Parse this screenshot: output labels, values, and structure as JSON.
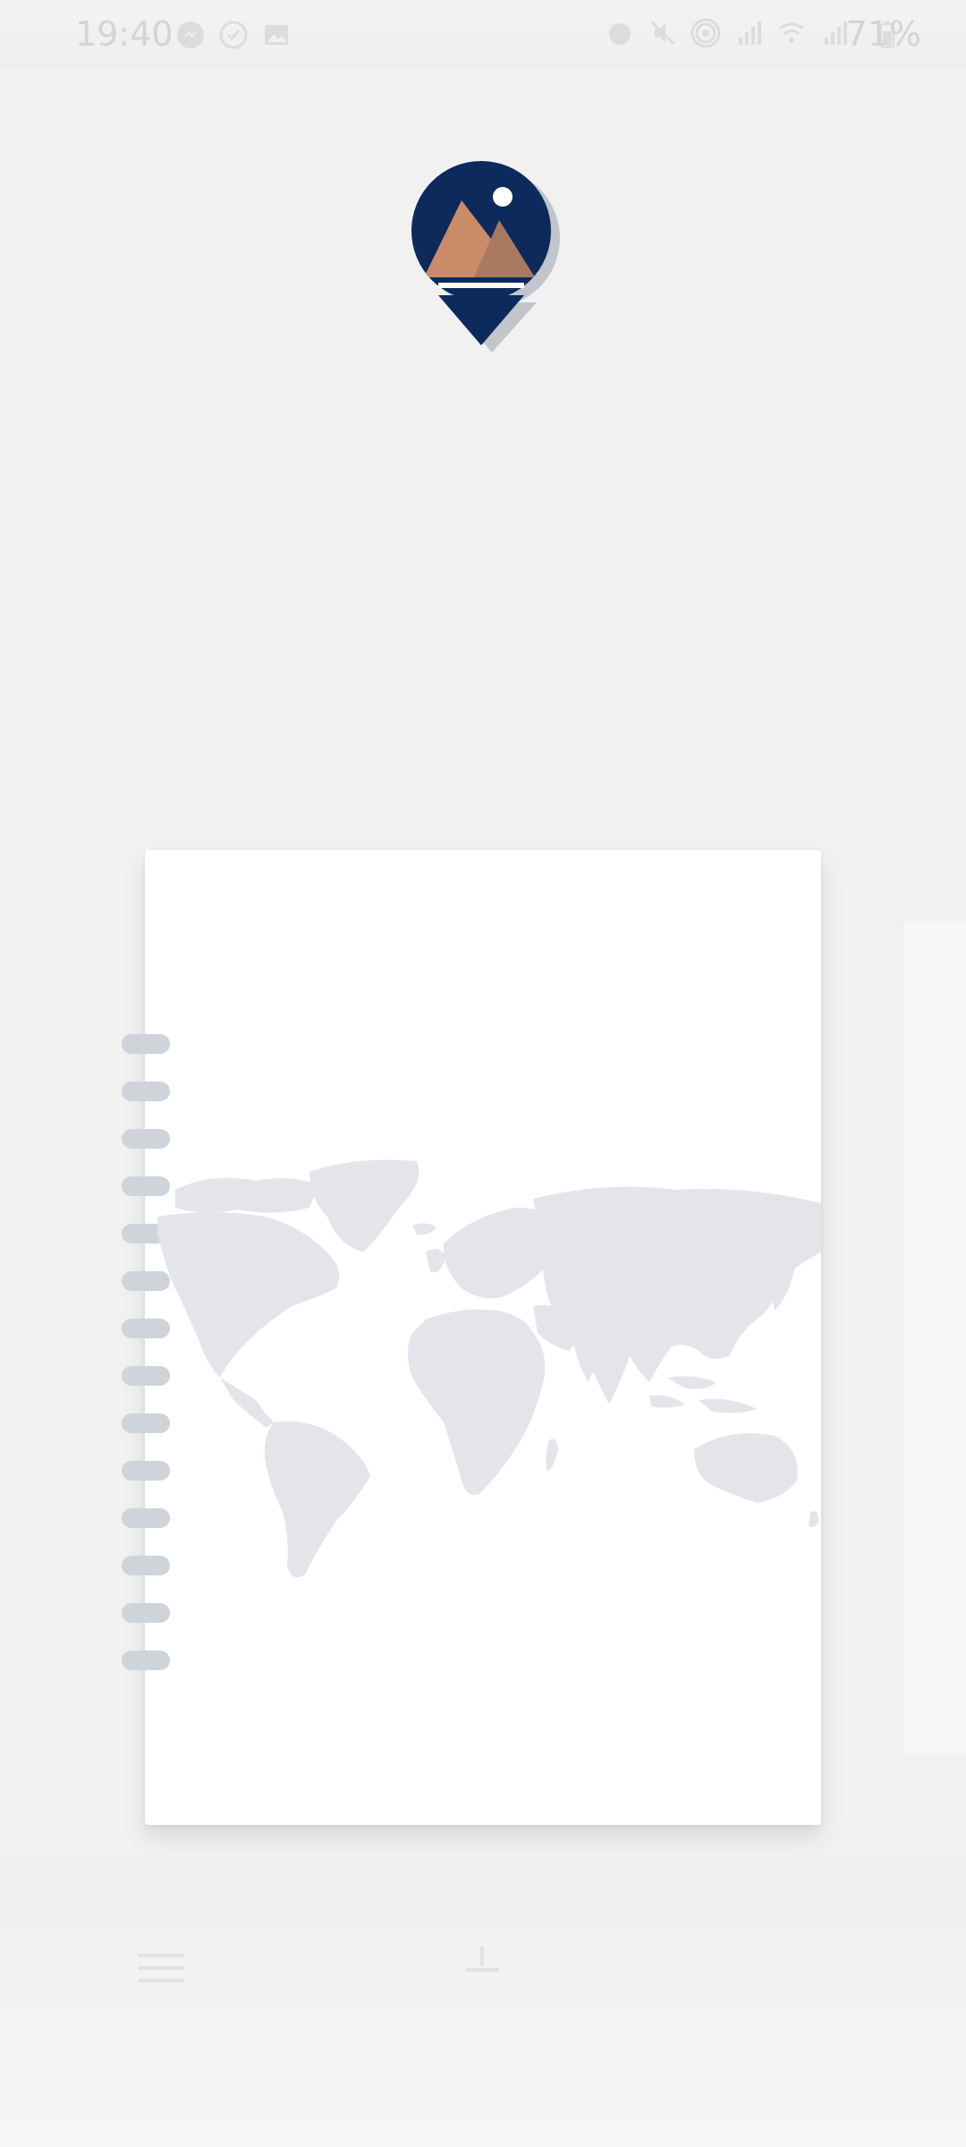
{
  "status_bar": {
    "time": "19:40",
    "battery": "71%",
    "left_icons": [
      "messenger-icon",
      "check-circle-icon",
      "gallery-icon"
    ],
    "right_icons": [
      "alarm-icon",
      "mute-icon",
      "hotspot-icon",
      "signal-icon",
      "wifi-calling-icon",
      "signal-icon"
    ]
  },
  "colors": {
    "logo_navy": "#0c2a5c",
    "logo_mountain": "#c98b68",
    "map_gray": "#e4e5ea",
    "ring_gray": "#cfd3da",
    "background": "#f1f1f2"
  },
  "toolbar": {
    "icons": [
      "menu-icon",
      "upload-icon"
    ]
  }
}
